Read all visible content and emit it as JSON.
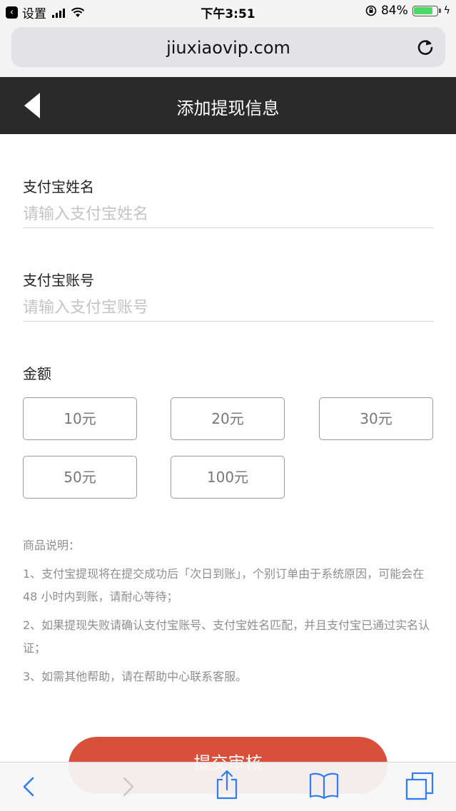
{
  "status_bar": {
    "back_app_label": "设置",
    "time": "下午3:51",
    "battery_percent": "84%",
    "battery_level": 0.84
  },
  "address_bar": {
    "url": "jiuxiaovip.com"
  },
  "header": {
    "title": "添加提现信息"
  },
  "form": {
    "name_label": "支付宝姓名",
    "name_placeholder": "请输入支付宝姓名",
    "account_label": "支付宝账号",
    "account_placeholder": "请输入支付宝账号",
    "amount_label": "金额",
    "amounts": [
      "10元",
      "20元",
      "30元",
      "50元",
      "100元"
    ]
  },
  "notes": {
    "title": "商品说明：",
    "items": [
      "1、支付宝提现将在提交成功后「次日到账」，个别订单由于系统原因，可能会在 48 小时内到账，请耐心等待；",
      "2、如果提现失败请确认支付宝账号、支付宝姓名匹配，并且支付宝已通过实名认证；",
      "3、如需其他帮助，请在帮助中心联系客服。"
    ]
  },
  "submit": {
    "label": "提交审核"
  },
  "colors": {
    "header_bg": "#2a2a2a",
    "submit_bg": "#d9503a",
    "link_blue": "#2f7cf6",
    "battery_green": "#4cd964"
  }
}
